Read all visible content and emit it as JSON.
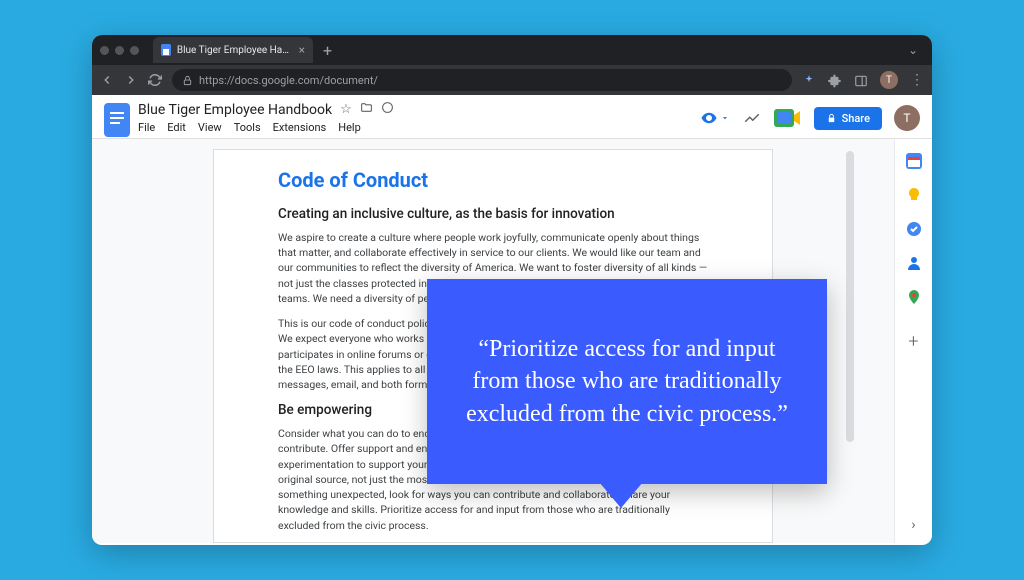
{
  "browser": {
    "tab_title": "Blue Tiger Employee Handbook",
    "url": "https://docs.google.com/document/",
    "new_tab_label": "+",
    "tab_close": "×",
    "chevron": "⌄",
    "avatar_letter": "T",
    "more": "⋮"
  },
  "docs": {
    "title": "Blue Tiger Employee Handbook",
    "star": "☆",
    "folder": "▭",
    "cloud": "ⓘ",
    "menus": [
      "File",
      "Edit",
      "View",
      "Tools",
      "Extensions",
      "Help"
    ],
    "share_label": "Share",
    "avatar_letter": "T"
  },
  "document": {
    "heading": "Code of Conduct",
    "section1_title": "Creating an inclusive culture, as the basis for innovation",
    "section1_p1": "We aspire to create a culture where people work joyfully, communicate openly about things that matter, and collaborate effectively in service to our clients. We would like our team and our communities to reflect the diversity of America. We want to foster diversity of all kinds — not just the classes protected in law. It's the right thing to do, and diverse teams are creative teams. We need a diversity of perspective to create truly innovative solutions for our clients.",
    "section1_p2": "This is our code of conduct policy. All of our staff are governed at all times by the EEO laws. We expect everyone who works with Blue Tiger, attends our events and meetings, or participates in online forums or other virtual collaboration to follow this code of conduct and the EEO laws. This applies to all of our methods of communication: chatrooms, commit messages, email, and both formal and informal conversation.",
    "section2_title": "Be empowering",
    "section2_p1": "Consider what you can do to encourage and support others. Make room for quieter voices to contribute. Offer support and enthusiasm for great ideas. Leverage the low cost of experimentation to support your colleagues' ideas, and take care to acknowledge the original source, not just the most recent or loudest contributor. When someone offers something unexpected, look for ways you can contribute and collaborate. Share your knowledge and skills. Prioritize access for and input from those who are traditionally excluded from the civic process."
  },
  "quote": "“Prioritize access for and input from those who are traditionally excluded from the civic process.”",
  "side": {
    "add": "+",
    "expand": "›"
  }
}
